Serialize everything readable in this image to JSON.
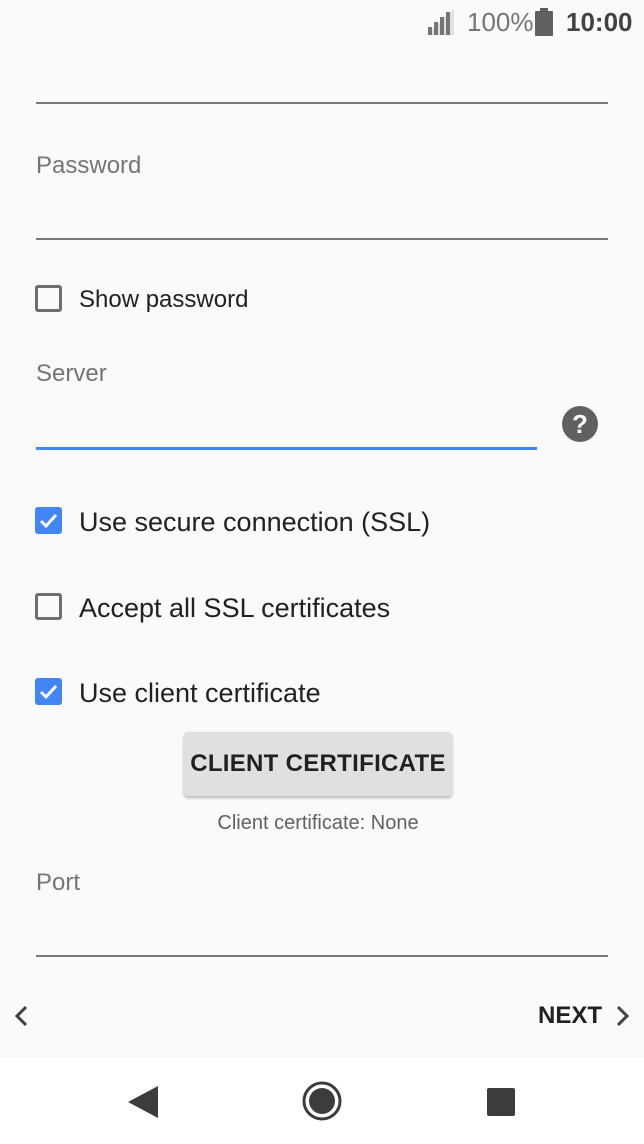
{
  "status_bar": {
    "battery_percent": "100%",
    "time": "10:00",
    "icons": [
      "signal-icon",
      "battery-icon"
    ]
  },
  "form": {
    "username": {
      "value": ""
    },
    "password": {
      "label": "Password",
      "value": ""
    },
    "show_password": {
      "label": "Show password",
      "checked": false
    },
    "server": {
      "label": "Server",
      "value": "",
      "help_icon": "help-icon"
    },
    "use_ssl": {
      "label": "Use secure connection (SSL)",
      "checked": true
    },
    "accept_all_ssl": {
      "label": "Accept all SSL certificates",
      "checked": false
    },
    "use_client_cert": {
      "label": "Use client certificate",
      "checked": true
    },
    "client_certificate_button": {
      "label": "CLIENT CERTIFICATE"
    },
    "client_certificate_status": "Client certificate: None",
    "port": {
      "label": "Port",
      "value": ""
    }
  },
  "navigation": {
    "back_icon": "chevron-left-icon",
    "next_label": "NEXT",
    "next_icon": "chevron-right-icon"
  },
  "system_nav": {
    "icons": [
      "back-triangle-icon",
      "home-circle-icon",
      "recent-square-icon"
    ]
  },
  "colors": {
    "accent": "#4285f4",
    "background": "#fafafa",
    "underline": "#7a7a7a",
    "label": "#757575"
  }
}
